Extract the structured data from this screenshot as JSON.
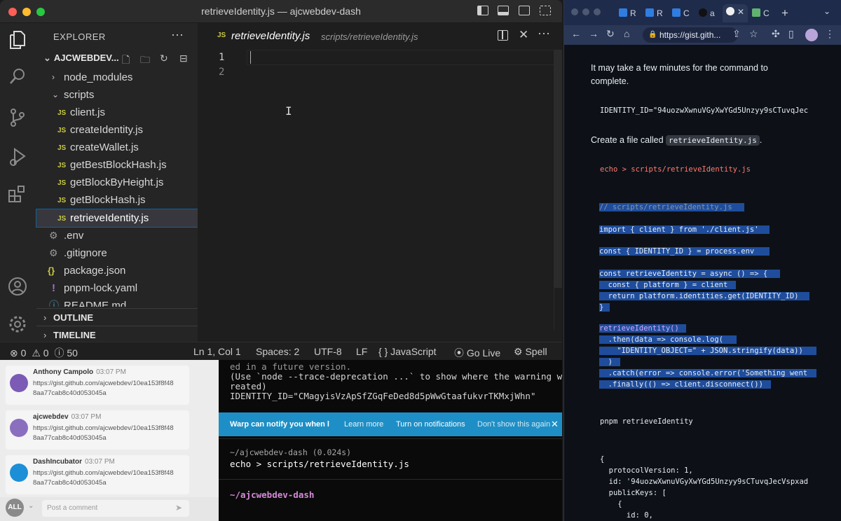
{
  "vscode": {
    "window_title": "retrieveIdentity.js — ajcwebdev-dash",
    "explorer_title": "EXPLORER",
    "project_name": "AJCWEBDEV...",
    "tree": [
      {
        "label": "node_modules",
        "type": "folder",
        "state": "collapsed"
      },
      {
        "label": "scripts",
        "type": "folder",
        "state": "expanded"
      },
      {
        "label": "client.js",
        "type": "js"
      },
      {
        "label": "createIdentity.js",
        "type": "js"
      },
      {
        "label": "createWallet.js",
        "type": "js"
      },
      {
        "label": "getBestBlockHash.js",
        "type": "js"
      },
      {
        "label": "getBlockByHeight.js",
        "type": "js"
      },
      {
        "label": "getBlockHash.js",
        "type": "js"
      },
      {
        "label": "retrieveIdentity.js",
        "type": "js",
        "selected": true
      },
      {
        "label": ".env",
        "type": "gear"
      },
      {
        "label": ".gitignore",
        "type": "gear"
      },
      {
        "label": "package.json",
        "type": "json"
      },
      {
        "label": "pnpm-lock.yaml",
        "type": "yaml"
      },
      {
        "label": "README.md",
        "type": "info"
      }
    ],
    "outline_label": "OUTLINE",
    "timeline_label": "TIMELINE",
    "tab": {
      "icon": "JS",
      "name": "retrieveIdentity.js",
      "path": "scripts/retrieveIdentity.js"
    },
    "line_numbers": [
      "1",
      "2"
    ],
    "status": {
      "errors": "0",
      "warnings": "0",
      "info": "50",
      "position": "Ln 1, Col 1",
      "spaces": "Spaces: 2",
      "encoding": "UTF-8",
      "eol": "LF",
      "language": "JavaScript",
      "golive": "Go Live",
      "spell": "Spell"
    }
  },
  "comments": {
    "items": [
      {
        "author": "Anthony Campolo",
        "time": "03:07 PM",
        "line1": "https://gist.github.com/ajcwebdev/10ea153f8f48",
        "line2": "8aa77cab8c40d053045a",
        "avatar_color": "#7b5bb5"
      },
      {
        "author": "ajcwebdev",
        "time": "03:07 PM",
        "line1": "https://gist.github.com/ajcwebdev/10ea153f8f48",
        "line2": "8aa77cab8c40d053045a",
        "avatar_color": "#8a6fbf"
      },
      {
        "author": "DashIncubator",
        "time": "03:07 PM",
        "line1": "https://gist.github.com/ajcwebdev/10ea153f8f48",
        "line2": "8aa77cab8c40d053045a",
        "avatar_color": "#1c8fd6"
      }
    ],
    "all_label": "ALL",
    "input_placeholder": "Post a comment"
  },
  "terminal": {
    "lines_top": [
      "ed in a future version.",
      "(Use `node --trace-deprecation ...` to show where the warning was c",
      "reated)",
      "IDENTITY_ID=\"CMagyisVzApSfZGqFeDed8d5pWwGtaafukvrTKMxjWhn\""
    ],
    "warp": {
      "message": "Warp can notify you when l",
      "learn_more": "Learn more",
      "turn_on": "Turn on notifications",
      "dont_show": "Don't show this again"
    },
    "prompt1": "~/ajcwebdev-dash (0.024s)",
    "command1": "echo > scripts/retrieveIdentity.js",
    "prompt2": "~/ajcwebdev-dash"
  },
  "browser": {
    "tabs": [
      "R",
      "R",
      "C",
      "a",
      "",
      "C"
    ],
    "url": "https://gist.gith...",
    "page": {
      "p1": "It may take a few minutes for the command to complete.",
      "code1": "IDENTITY_ID=\"94uozwXwnuVGyXwYGd5Unzyy9sCTuvqJec",
      "p2_before": "Create a file called",
      "p2_code": "retrieveIdentity.js",
      "p2_after": ".",
      "code2": "echo > scripts/retrieveIdentity.js",
      "code3_comment": "// scripts/retrieveIdentity.js",
      "code3_import": "import { client } from './client.js'",
      "code3_const": "const { IDENTITY_ID } = process.env",
      "code3_fn1": "const retrieveIdentity = async () => {",
      "code3_fn2": "  const { platform } = client",
      "code3_fn3": "  return platform.identities.get(IDENTITY_ID)",
      "code3_fn4": "}",
      "code3_call1": "retrieveIdentity()",
      "code3_call2": "  .then(data => console.log(",
      "code3_call3": "    \"IDENTITY_OBJECT=\" + JSON.stringify(data))",
      "code3_call4": "  )",
      "code3_call5": "  .catch(error => console.error('Something went",
      "code3_call6": "  .finally(() => client.disconnect())",
      "code4": "pnpm retrieveIdentity",
      "code5_l1": "{",
      "code5_l2": "  protocolVersion: 1,",
      "code5_l3": "  id: '94uozwXwnuVGyXwYGd5Unzyy9sCTuvqJecVspxad",
      "code5_l4": "  publicKeys: [",
      "code5_l5": "    {",
      "code5_l6": "      id: 0,"
    }
  }
}
